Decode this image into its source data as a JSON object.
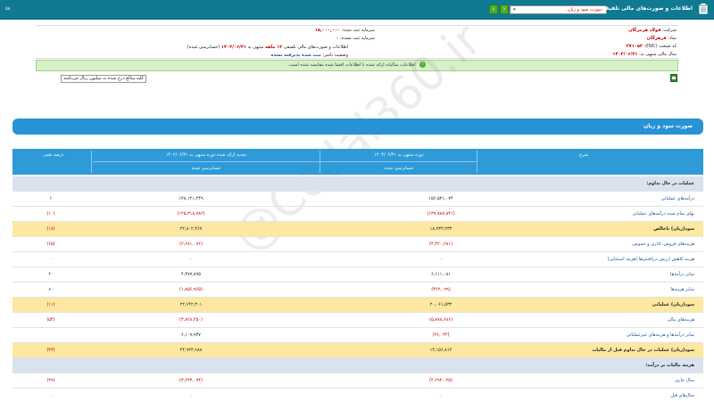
{
  "topbar": {
    "version": "۵۸",
    "title": "اطلاعات و صورت‌های مالی تلفیقی",
    "selected_statement": "صورت سود و زیان",
    "nav_next": "‹",
    "nav_prev": "›",
    "caret": "▾"
  },
  "info": {
    "company_label": "شرکت:",
    "company_value": "فولاد هرمزگان",
    "symbol_label": "نماد:",
    "symbol_value": "فرهزگان",
    "isic_label": "کد صنعت (ISIC):",
    "isic_value": "۲۷۱۰۵۲",
    "fiscal_end_label": "سال مالی منتهی به:",
    "fiscal_end_value": "۱۴۰۳/۰۶/۳۱",
    "registered_capital_label": "سرمایه ثبت شده:",
    "registered_capital_value": "۱۵,۰۰۰,۰۰۰",
    "unregistered_capital_label": "سرمایه ثبت نشده:",
    "unregistered_capital_value": "۰",
    "report_label": "اطلاعات و صورت‌های مالی تلفیقی",
    "report_period": "۱۲ ماهه",
    "report_end_label": "منتهی به",
    "report_end_value": "۱۴۰۳/۰۶/۳۱",
    "report_audit": "(حسابرسی شده)",
    "status_label": "وضعیت ناشر:",
    "status_value": "ثبت شده پذیرفته نشده"
  },
  "notice": {
    "icon": "i",
    "text": "اطلاعات سالیانه ارائه شده با اطلاعات افشا شده مقایسه شده است."
  },
  "unit": {
    "text": "کلیه مبالغ درج شده به میلیون ریال می‌باشد"
  },
  "watermark": "@Codal360.ir",
  "statement": {
    "title": "صورت سود و زیان",
    "headers": {
      "desc": "شرح",
      "period1": "دوره منتهی به ۱۴۰۳/۰۶/۳۱",
      "period1_status": "حسابرسی شده",
      "period2": "تجدید ارائه شده دوره منتهی به ۱۴۰۲/۰۶/۳۱",
      "period2_status": "حسابرسی شده",
      "change": "درصد تغییر"
    },
    "rows": [
      {
        "type": "section",
        "label": "عملیات در حال تداوم:",
        "c1": "",
        "c2": "",
        "c3": ""
      },
      {
        "type": "normal",
        "label": "درآمدهای عملیاتی",
        "c1": "۱۵۶,۵۲۱,۰۷۴",
        "c2": "۱۴۸,۱۲۱,۲۴۹",
        "c3": "۶"
      },
      {
        "type": "normal",
        "label": "بهای تمام شده درآمدهای عملیاتی",
        "c1": "(۱۳۷,۷۸۷,۸۴۱)",
        "c2": "(۱۲۵,۳۱۸,۷۸۲)",
        "c3": "(۱۰)"
      },
      {
        "type": "highlight",
        "label": "سود(زیان) ناخالص",
        "c1": "۱۸,۷۳۳,۲۳۳",
        "c2": "۲۲,۸۰۲,۴۶۷",
        "c3": "(۱۸)"
      },
      {
        "type": "normal",
        "label": "هزینه‌های فروش، اداری و عمومی",
        "c1": "(۴,۴۲۰,۶۸۱)",
        "c2": "(۲,۶۸۱,۰۷۶)",
        "c3": "(۶۵)"
      },
      {
        "type": "normal",
        "label": "هزینه کاهش ارزش دریافتنی‌ها (هزینه استثنایی)",
        "c1": "۰",
        "c2": "۰",
        "c3": "۰"
      },
      {
        "type": "normal",
        "label": "سایر درآمدها",
        "c1": "۶,۱۱۱,۰۸۱",
        "c2": "۴,۳۷۷,۸۷۵",
        "c3": "۴۰"
      },
      {
        "type": "normal",
        "label": "سایر هزینه‌ها",
        "c1": "(۳۶۲,۰۹۹)",
        "c2": "(۱,۸۵۶,۹۶۵)",
        "c3": "۸۰"
      },
      {
        "type": "highlight",
        "label": "سود(زیان) عملیاتی",
        "c1": "۲۰,۰۶۱,۵۳۴",
        "c2": "۲۲,۶۴۲,۳۰۱",
        "c3": "(۱۱)"
      },
      {
        "type": "normal",
        "label": "هزینه‌های مالی",
        "c1": "(۵,۸۷۸,۶۸۶)",
        "c2": "(۳,۸۲۸,۲۵۰)",
        "c3": "(۵۴)"
      },
      {
        "type": "normal",
        "label": "سایر درآمدها و هزینه‌های غیرعملیاتی",
        "c1": "(۲۶,۰۳۴)",
        "c2": "۶,۱۰۹,۹۳۷",
        "c3": ""
      },
      {
        "type": "highlight",
        "label": "سود(زیان) عملیات در حال تداوم قبل از مالیات",
        "c1": "۱۴,۱۵۶,۸۱۴",
        "c2": "۲۴,۹۲۳,۹۸۸",
        "c3": "(۴۳)"
      },
      {
        "type": "section",
        "label": "هزینه مالیات بر درآمد:",
        "c1": "",
        "c2": "",
        "c3": ""
      },
      {
        "type": "normal",
        "label": "سال جاری",
        "c1": "(۴,۶۹۲,۰۲۵)",
        "c2": "(۳,۶۲۳,۰۷۴)",
        "c3": "(۲۹)"
      },
      {
        "type": "normal",
        "label": "سال‌های قبل",
        "c1": "۰",
        "c2": "۰",
        "c3": "۰"
      },
      {
        "type": "normal",
        "label": "سود(زیان) خالص عملیات در حال تداوم",
        "c1": "۹,۴۶۴,۷۸۹",
        "c2": "۲۱,۳۰۰,۹۱۴",
        "c3": "(۵۶)"
      }
    ]
  }
}
